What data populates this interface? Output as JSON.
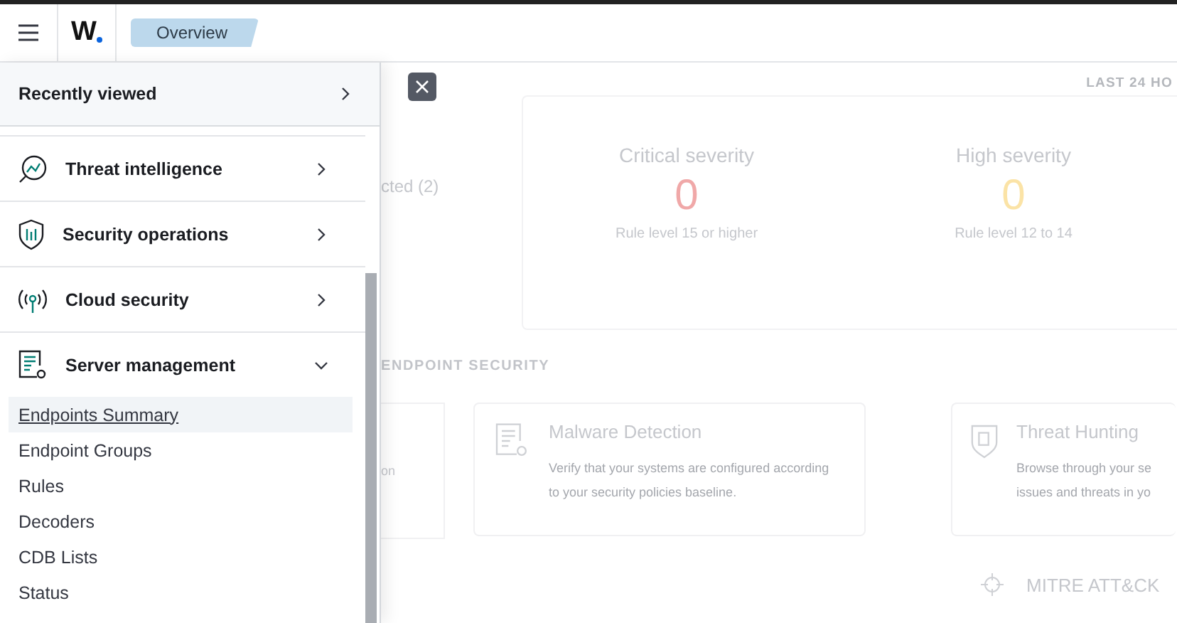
{
  "topbar": {
    "logo": "W",
    "breadcrumb": "Overview"
  },
  "nav": {
    "header": "Recently viewed",
    "sections": [
      {
        "label": "Threat intelligence",
        "expanded": false
      },
      {
        "label": "Security operations",
        "expanded": false
      },
      {
        "label": "Cloud security",
        "expanded": false
      },
      {
        "label": "Server management",
        "expanded": true,
        "children": [
          {
            "label": "Endpoints Summary",
            "selected": true
          },
          {
            "label": "Endpoint Groups",
            "selected": false
          },
          {
            "label": "Rules",
            "selected": false
          },
          {
            "label": "Decoders",
            "selected": false
          },
          {
            "label": "CDB Lists",
            "selected": false
          },
          {
            "label": "Status",
            "selected": false
          }
        ]
      }
    ]
  },
  "dashboard": {
    "range": "LAST 24 HO",
    "agents_text": "cted (2)",
    "severities": [
      {
        "title": "Critical severity",
        "count": "0",
        "rule": "Rule level 15 or higher",
        "color": "#f0a8a8"
      },
      {
        "title": "High severity",
        "count": "0",
        "rule": "Rule level 12 to 14",
        "color": "#fbe3a6"
      }
    ],
    "section_title": "ENDPOINT SECURITY",
    "partial_text": "on",
    "modules": [
      {
        "title": "Malware Detection",
        "description": "Verify that your systems are configured according to your security policies baseline."
      },
      {
        "title": "Threat Hunting",
        "description": "Browse through your se issues and threats in yo"
      }
    ],
    "next_module": "MITRE ATT&CK"
  }
}
